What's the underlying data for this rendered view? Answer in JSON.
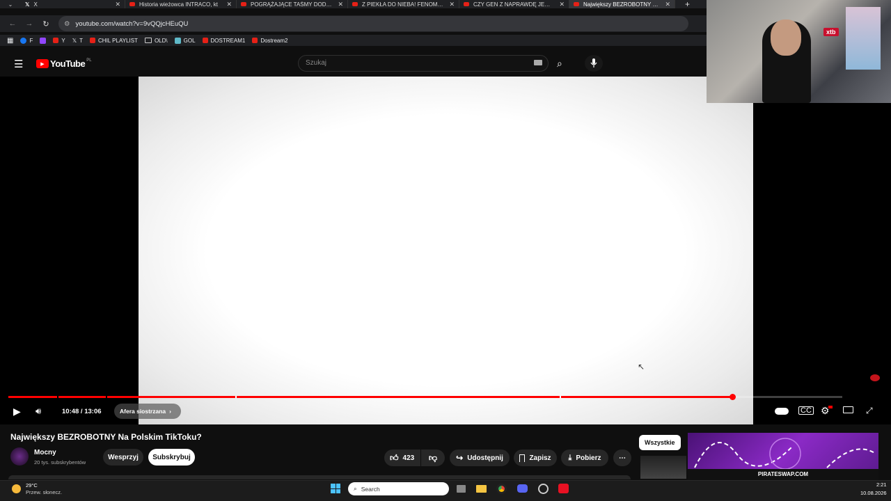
{
  "browser": {
    "tabs": [
      {
        "label": "X",
        "active": false
      },
      {
        "label": "Historia wieżowca INTRACO, kt",
        "active": false
      },
      {
        "label": "POGRĄŻAJĄCE TAŚMY DODY?",
        "active": false
      },
      {
        "label": "Z PIEKŁA DO NIEBA! FENOMEN",
        "active": false
      },
      {
        "label": "CZY GEN Z NAPRAWDĘ JEST G",
        "active": false
      },
      {
        "label": "Największy BEZROBOTNY Na P",
        "active": true
      }
    ],
    "new_tab": "+",
    "url": "youtube.com/watch?v=9vQQjcHEuQU",
    "bookmarks": [
      "F",
      "",
      "Y",
      "T",
      "CHIL PLAYLIST",
      "OLD\\",
      "GOL",
      "DOSTREAM1",
      "Dostream2"
    ]
  },
  "youtube": {
    "logo": "YouTube",
    "region": "PL",
    "search_placeholder": "Szukaj"
  },
  "player": {
    "progress": 0.868,
    "time": "10:48 / 13:06",
    "chapter": "Afera siostrzana"
  },
  "video": {
    "title": "Największy BEZROBOTNY Na Polskim TikToku?",
    "channel": "Mocny",
    "subscribers": "20 tys. subskrybentów",
    "support": "Wesprzyj",
    "subscribe": "Subskrybuj",
    "likes": "423",
    "share": "Udostępnij",
    "save": "Zapisz",
    "download": "Pobierz",
    "filter_all": "Wszystkie"
  },
  "overlay": {
    "ad_text": "PIRATESWAP.COM",
    "cam_badge": "xtb"
  },
  "taskbar": {
    "weather_temp": "29°C",
    "weather_desc": "Przew. słonecz.",
    "search": "Search",
    "time": "2:21",
    "date": "10.08.2026"
  },
  "colors": {
    "accent": "#ff0000"
  }
}
